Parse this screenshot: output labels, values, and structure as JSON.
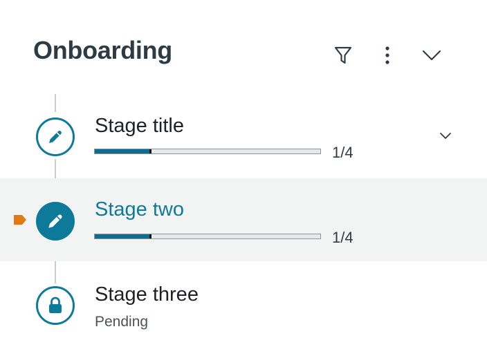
{
  "header": {
    "title": "Onboarding"
  },
  "stages": [
    {
      "title": "Stage title",
      "progress_text": "1/4",
      "progress_fraction": 0.25,
      "icon": "pencil-icon",
      "state": "in-progress"
    },
    {
      "title": "Stage two",
      "progress_text": "1/4",
      "progress_fraction": 0.25,
      "icon": "pencil-icon",
      "state": "current"
    },
    {
      "title": "Stage three",
      "status": "Pending",
      "icon": "lock-icon",
      "state": "locked"
    }
  ],
  "colors": {
    "accent": "#0e7a99",
    "marker": "#e17a15",
    "active_row_bg": "#f2f4f4"
  }
}
